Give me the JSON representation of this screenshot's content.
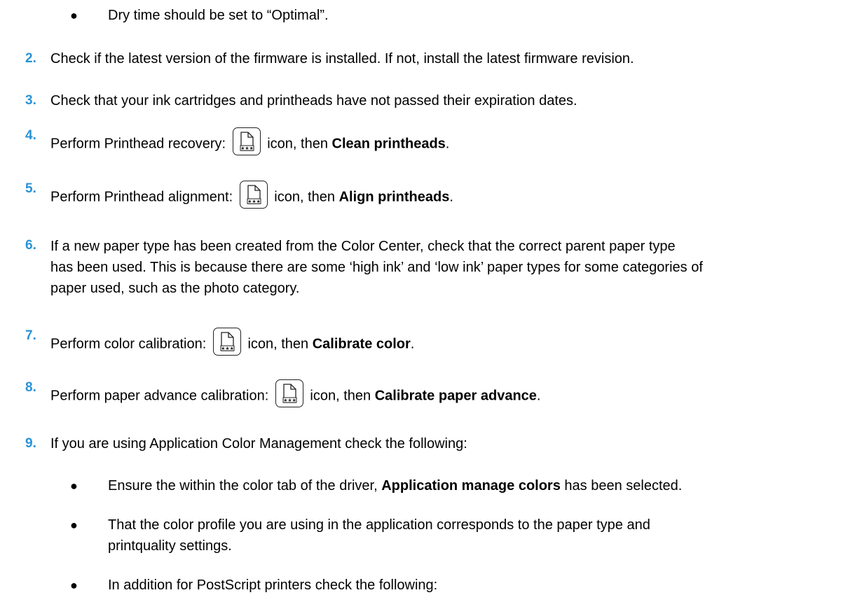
{
  "top_bullet": "Dry time should be set to “Optimal”.",
  "steps": [
    {
      "num": "2.",
      "text": "Check if the latest version of the firmware is installed. If not, install the latest firmware revision."
    },
    {
      "num": "3.",
      "text": "Check that your ink cartridges and printheads have not passed their expiration dates."
    },
    {
      "num": "4.",
      "pre": "Perform Printhead recovery:",
      "mid": "icon, then",
      "bold": "Clean printheads",
      "end": "."
    },
    {
      "num": "5.",
      "pre": "Perform Printhead alignment:",
      "mid": "icon, then",
      "bold": "Align printheads",
      "end": "."
    },
    {
      "num": "6.",
      "lines": [
        "If a new paper type has been created from the Color Center, check that the correct parent paper type",
        "has been used. This is because there are some ‘high ink’ and ‘low ink’ paper types for some categories of",
        "paper used, such as the photo category."
      ]
    },
    {
      "num": "7.",
      "pre": "Perform color calibration:",
      "mid": "icon, then",
      "bold": "Calibrate color",
      "end": "."
    },
    {
      "num": "8.",
      "pre": "Perform paper advance calibration:",
      "mid": "icon, then",
      "bold": "Calibrate paper advance",
      "end": "."
    },
    {
      "num": "9.",
      "text": "If you are using Application Color Management check the following:"
    }
  ],
  "sub_bullets": [
    {
      "pre": "Ensure the within the color tab of the driver,",
      "bold": "Application manage colors",
      "post": "has been selected."
    },
    {
      "lines": [
        "That the color profile you are using in the application corresponds to the paper type and",
        "printquality settings."
      ]
    },
    {
      "text": "In addition for PostScript printers check the following:"
    }
  ],
  "bullet_glyph": "●",
  "icon_name": "image-quality-menu-icon",
  "colors": {
    "step_number": "#2a92d6",
    "text": "#000000"
  }
}
